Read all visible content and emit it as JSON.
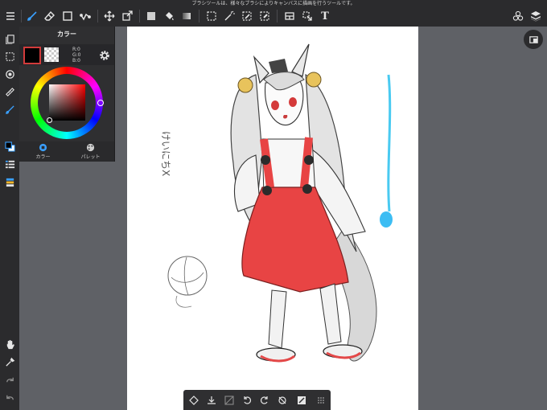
{
  "app": {
    "hint_text": "ブラシツールは、様々なブラシによりキャンバスに描画を行うツールです。"
  },
  "toolbar": {
    "icons": [
      "menu-icon",
      "brush-icon",
      "eraser-icon",
      "rectangle-icon",
      "line-icon",
      "move-icon",
      "transform-icon",
      "fill-rect-icon",
      "bucket-icon",
      "gradient-icon",
      "select-icon",
      "magic-wand-icon",
      "lasso-fill-icon",
      "select-pen-icon",
      "layout-icon",
      "select-move-icon",
      "text-icon",
      "materials-icon",
      "layers-icon"
    ],
    "text_tool_label": "T"
  },
  "color_panel": {
    "title": "カラー",
    "rgb": {
      "r": "R:0",
      "g": "G:0",
      "b": "B:0"
    },
    "main_color": "#000000",
    "tabs": [
      {
        "label": "カラー"
      },
      {
        "label": "パレット"
      }
    ]
  },
  "colors": {
    "accent": "#3aa0ff",
    "canvas": "#ffffff",
    "workspace": "#5f6166",
    "toolbar": "#2b2b2d"
  },
  "bottom_toolbar": {
    "icons": [
      "snap-icon",
      "import-icon",
      "transform-grid-icon",
      "rotate-ccw-icon",
      "rotate-cw-icon",
      "flip-icon",
      "fit-icon",
      "more-icon"
    ]
  },
  "canvas": {
    "sketch_text": "けいにちX"
  }
}
